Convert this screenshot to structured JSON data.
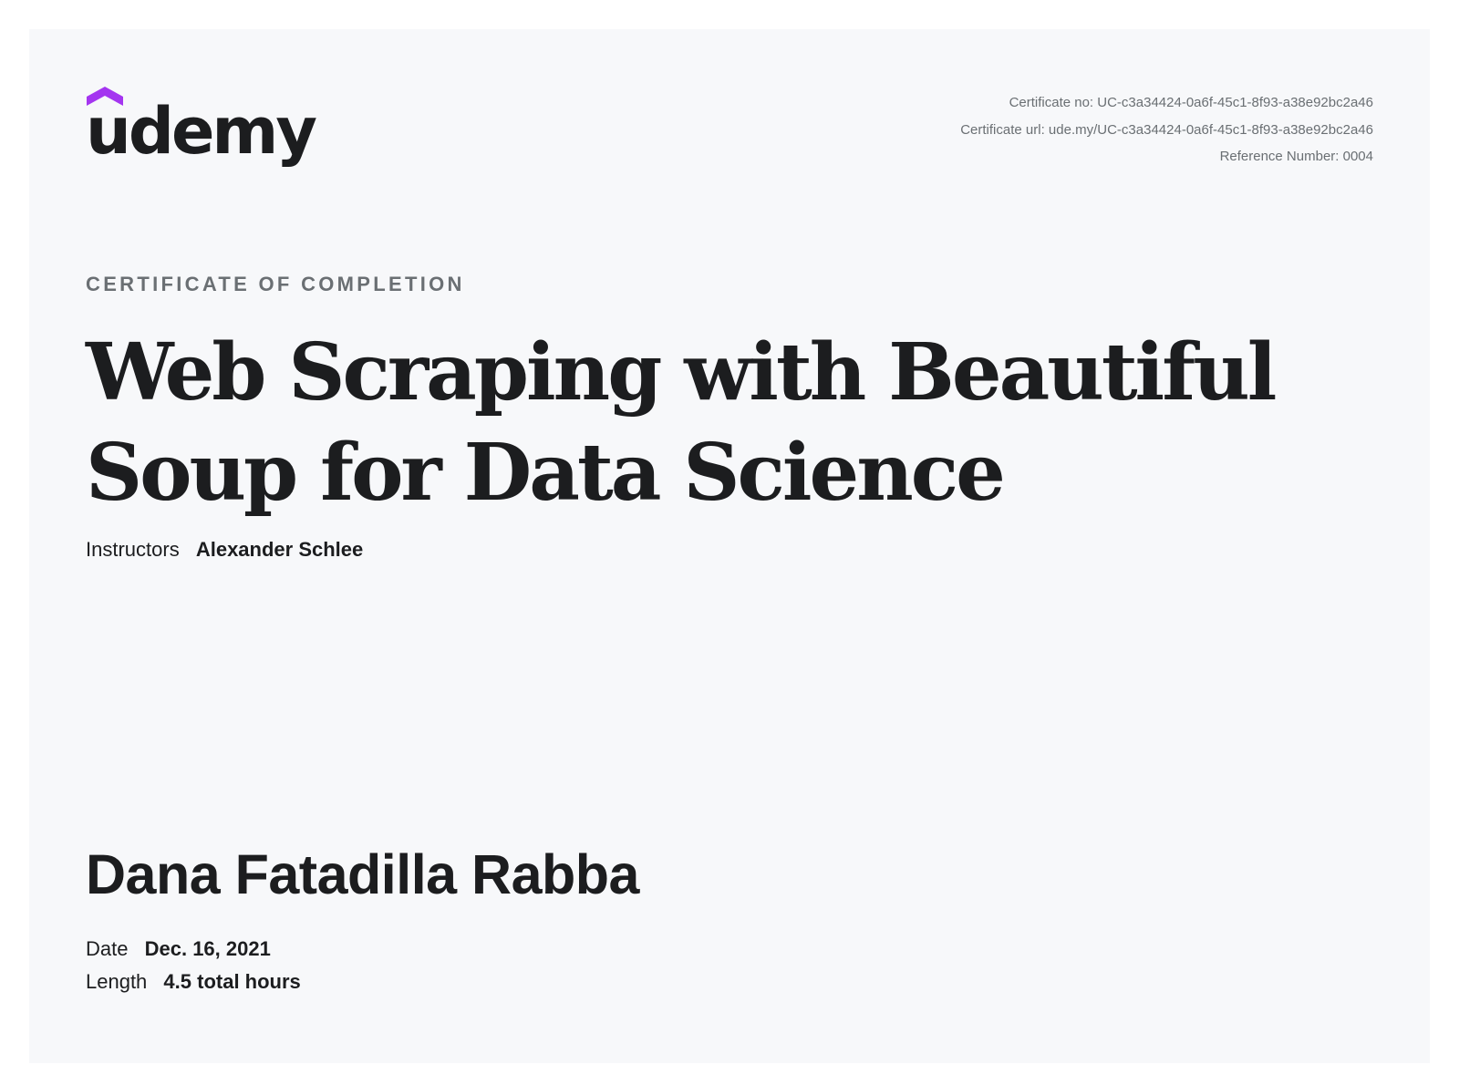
{
  "brand": {
    "name": "udemy",
    "accent_color": "#a435f0",
    "icon": "udemy-hat-icon"
  },
  "certificate": {
    "number_line": "Certificate no: UC-c3a34424-0a6f-45c1-8f93-a38e92bc2a46",
    "url_line": "Certificate url: ude.my/UC-c3a34424-0a6f-45c1-8f93-a38e92bc2a46",
    "reference_line": "Reference Number: 0004",
    "heading": "CERTIFICATE OF COMPLETION"
  },
  "course": {
    "title": "Web Scraping with Beautiful Soup for Data Science",
    "instructors_label": "Instructors",
    "instructors": "Alexander Schlee"
  },
  "recipient": {
    "name": "Dana Fatadilla Rabba"
  },
  "details": {
    "date_label": "Date",
    "date_value": "Dec. 16, 2021",
    "length_label": "Length",
    "length_value": "4.5 total hours"
  }
}
